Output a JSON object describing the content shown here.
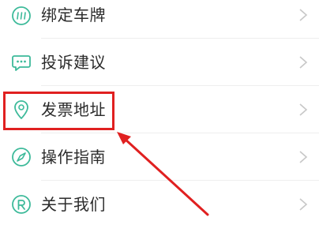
{
  "menu": {
    "items": [
      {
        "key": "bind-plate",
        "label": "绑定车牌",
        "icon": "license-plate-icon"
      },
      {
        "key": "complaint",
        "label": "投诉建议",
        "icon": "chat-bubble-icon"
      },
      {
        "key": "invoice-address",
        "label": "发票地址",
        "icon": "location-pin-icon"
      },
      {
        "key": "guide",
        "label": "操作指南",
        "icon": "compass-icon"
      },
      {
        "key": "about",
        "label": "关于我们",
        "icon": "brand-r-icon"
      }
    ]
  },
  "colors": {
    "icon": "#3dba9a",
    "highlight": "#e02020",
    "chevron": "#c8c8c8",
    "divider": "#eeeeee"
  }
}
